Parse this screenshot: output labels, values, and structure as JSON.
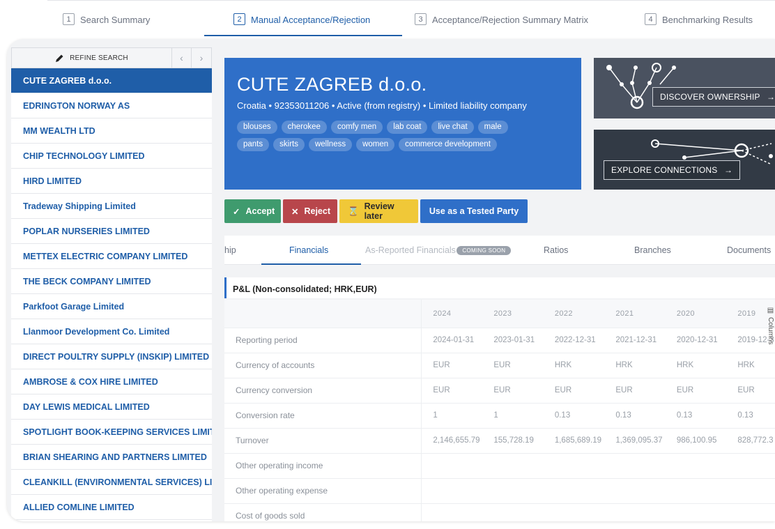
{
  "steps": [
    {
      "num": "1",
      "label": "Search Summary"
    },
    {
      "num": "2",
      "label": "Manual Acceptance/Rejection"
    },
    {
      "num": "3",
      "label": "Acceptance/Rejection Summary Matrix"
    },
    {
      "num": "4",
      "label": "Benchmarking Results"
    }
  ],
  "sidebar": {
    "refine_label": "REFINE SEARCH",
    "prev_icon": "chevron-left-icon",
    "next_icon": "chevron-right-icon",
    "companies": [
      "CUTE ZAGREB d.o.o.",
      "EDRINGTON NORWAY AS",
      "MM WEALTH LTD",
      "CHIP TECHNOLOGY LIMITED",
      "HIRD LIMITED",
      "Tradeway Shipping Limited",
      "POPLAR NURSERIES LIMITED",
      "METTEX ELECTRIC COMPANY LIMITED",
      "THE BECK COMPANY LIMITED",
      "Parkfoot Garage Limited",
      "Llanmoor Development Co. Limited",
      "DIRECT POULTRY SUPPLY (INSKIP) LIMITED",
      "AMBROSE & COX HIRE LIMITED",
      "DAY LEWIS MEDICAL LIMITED",
      "SPOTLIGHT BOOK-KEEPING SERVICES LIMIT...",
      "BRIAN SHEARING AND PARTNERS LIMITED",
      "CLEANKILL (ENVIRONMENTAL SERVICES) LI...",
      "ALLIED COMLINE LIMITED"
    ]
  },
  "company": {
    "name": "CUTE ZAGREB d.o.o.",
    "meta": "Croatia  •  92353011206  •  Active (from registry)  •  Limited liability company",
    "tags": [
      "blouses",
      "cherokee",
      "comfy men",
      "lab coat",
      "live chat",
      "male",
      "pants",
      "skirts",
      "wellness",
      "women",
      "commerce development"
    ]
  },
  "cards": {
    "discover": "DISCOVER OWNERSHIP",
    "explore": "EXPLORE CONNECTIONS"
  },
  "actions": {
    "accept": "Accept",
    "reject": "Reject",
    "review": "Review later",
    "tested": "Use as a Tested Party"
  },
  "detail_tabs": {
    "partial": "hip",
    "financials": "Financials",
    "as_reported": "As-Reported Financials",
    "coming_soon": "COMING SOON",
    "ratios": "Ratios",
    "branches": "Branches",
    "documents": "Documents"
  },
  "pl": {
    "title": "P&L (Non-consolidated; HRK,EUR)",
    "columns_label": "Columns",
    "years": [
      "2024",
      "2023",
      "2022",
      "2021",
      "2020",
      "2019"
    ],
    "rows": [
      {
        "label": "Reporting period",
        "values": [
          "2024-01-31",
          "2023-01-31",
          "2022-12-31",
          "2021-12-31",
          "2020-12-31",
          "2019-12-3"
        ]
      },
      {
        "label": "Currency of accounts",
        "values": [
          "EUR",
          "EUR",
          "HRK",
          "HRK",
          "HRK",
          "HRK"
        ]
      },
      {
        "label": "Currency conversion",
        "values": [
          "EUR",
          "EUR",
          "EUR",
          "EUR",
          "EUR",
          "EUR"
        ]
      },
      {
        "label": "Conversion rate",
        "values": [
          "1",
          "1",
          "0.13",
          "0.13",
          "0.13",
          "0.13"
        ]
      },
      {
        "label": "Turnover",
        "values": [
          "2,146,655.79",
          "155,728.19",
          "1,685,689.19",
          "1,369,095.37",
          "986,100.95",
          "828,772.3"
        ]
      },
      {
        "label": "Other operating income",
        "values": [
          "",
          "",
          "",
          "",
          "",
          ""
        ]
      },
      {
        "label": "Other operating expense",
        "values": [
          "",
          "",
          "",
          "",
          "",
          ""
        ]
      },
      {
        "label": "Cost of goods sold",
        "values": [
          "",
          "",
          "",
          "",
          "",
          ""
        ]
      }
    ]
  },
  "colors": {
    "primary": "#2f6fc8",
    "accept": "#3f9b6e",
    "reject": "#b8464b",
    "review": "#f0c838"
  }
}
